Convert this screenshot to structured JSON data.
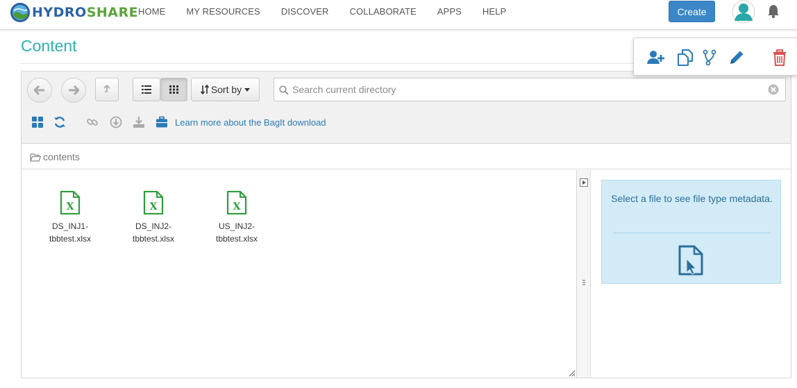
{
  "nav": {
    "logo_part1": "HYDRO",
    "logo_part2": "SHARE",
    "links": [
      "HOME",
      "MY RESOURCES",
      "DISCOVER",
      "COLLABORATE",
      "APPS",
      "HELP"
    ],
    "create_label": "Create"
  },
  "page": {
    "title": "Content"
  },
  "actions": {
    "icons": [
      "add-user-icon",
      "copy-icon",
      "version-icon",
      "edit-icon",
      "delete-icon"
    ]
  },
  "toolbar": {
    "sort_label": "Sort by",
    "search_placeholder": "Search current directory",
    "bagit_label": "Learn more about the BagIt download"
  },
  "breadcrumb": {
    "label": "contents"
  },
  "files": [
    {
      "name": "DS_INJ1-\ntbbtest.xlsx"
    },
    {
      "name": "DS_INJ2-\ntbbtest.xlsx"
    },
    {
      "name": "US_INJ2-\ntbbtest.xlsx"
    }
  ],
  "metadata": {
    "message": "Select a file to see file type metadata."
  },
  "colors": {
    "accent": "#2fb0b3",
    "primary": "#3a86c7",
    "excel_green": "#2d9d3a",
    "delete_red": "#d9534f",
    "info_bg": "#d3ebf6"
  }
}
